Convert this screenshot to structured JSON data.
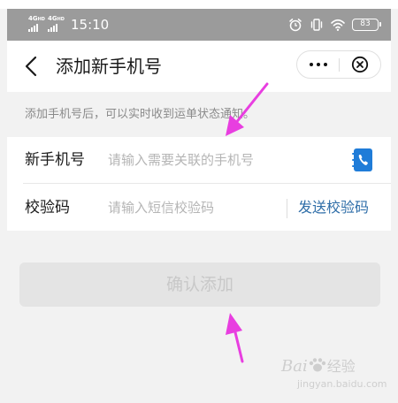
{
  "status_bar": {
    "network_1": "4G",
    "network_1_sub": "HD",
    "network_2": "4G",
    "network_2_sub": "HD",
    "time": "15:10",
    "battery": "83"
  },
  "nav": {
    "title": "添加新手机号"
  },
  "hint": "添加手机号后，可以实时收到运单状态通知。",
  "form": {
    "phone": {
      "label": "新手机号",
      "value": "",
      "placeholder": "请输入需要关联的手机号"
    },
    "code": {
      "label": "校验码",
      "value": "",
      "placeholder": "请输入短信校验码",
      "send_label": "发送校验码"
    }
  },
  "confirm_label": "确认添加",
  "watermark": {
    "text": "Bai",
    "text2": "经验",
    "sub": "jingyan.baidu.com"
  },
  "colors": {
    "status_bar_bg": "#9b9b9b",
    "link_blue": "#2f6ea8",
    "contact_icon_blue": "#1f7cd8",
    "annotation_magenta": "#e83ee0",
    "button_disabled_bg": "#e4e4e4"
  },
  "icons": {
    "back": "chevron-left-icon",
    "more": "more-dots-icon",
    "close": "close-circle-icon",
    "contact": "contact-book-icon",
    "alarm": "alarm-icon",
    "vibrate": "vibrate-icon",
    "wifi": "wifi-icon"
  }
}
